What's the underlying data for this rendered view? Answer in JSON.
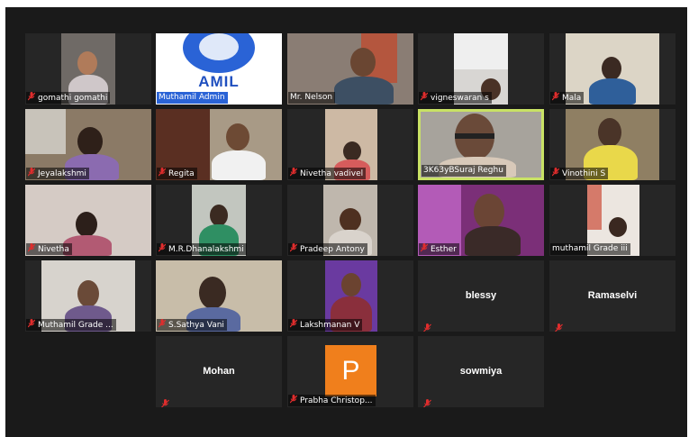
{
  "meeting": {
    "colors": {
      "background": "#1a1a1a",
      "tile": "#262626",
      "active_border": "#c9e265",
      "muted_icon": "#e02d2d",
      "avatar_orange": "#f07f1c"
    },
    "mute_icon": "muted-microphone-icon",
    "participants": [
      {
        "name": "gomathi gomathi",
        "muted": true
      },
      {
        "name": "Muthamil Admin",
        "muted": false,
        "logo_text": "AMIL"
      },
      {
        "name": "Mr. Nelson",
        "muted": false
      },
      {
        "name": "vigneswaran s",
        "muted": true
      },
      {
        "name": "Mala",
        "muted": true
      },
      {
        "name": "Jeyalakshmi",
        "muted": true
      },
      {
        "name": "Regita",
        "muted": true
      },
      {
        "name": "Nivetha vadivel",
        "muted": true
      },
      {
        "name": "3K63yBSuraj Reghu",
        "muted": false,
        "active_speaker": true
      },
      {
        "name": "Vinothini S",
        "muted": true
      },
      {
        "name": "Nivetha",
        "muted": true
      },
      {
        "name": "M.R.Dhanalakshmi",
        "muted": true
      },
      {
        "name": "Pradeep Antony",
        "muted": true
      },
      {
        "name": "Esther",
        "muted": true
      },
      {
        "name": "muthamil Grade iii",
        "muted": false
      },
      {
        "name": "Muthamil Grade ...",
        "muted": true
      },
      {
        "name": "S.Sathya Vani",
        "muted": true
      },
      {
        "name": "Lakshmanan V",
        "muted": true
      },
      {
        "name": "blessy",
        "muted": true,
        "video_off": true
      },
      {
        "name": "Ramaselvi",
        "muted": true,
        "video_off": true
      },
      {
        "name": "Mohan",
        "muted": true,
        "video_off": true
      },
      {
        "name": "Prabha Christop...",
        "muted": true,
        "video_off": true,
        "avatar_letter": "P"
      },
      {
        "name": "sowmiya",
        "muted": true,
        "video_off": true
      }
    ]
  }
}
